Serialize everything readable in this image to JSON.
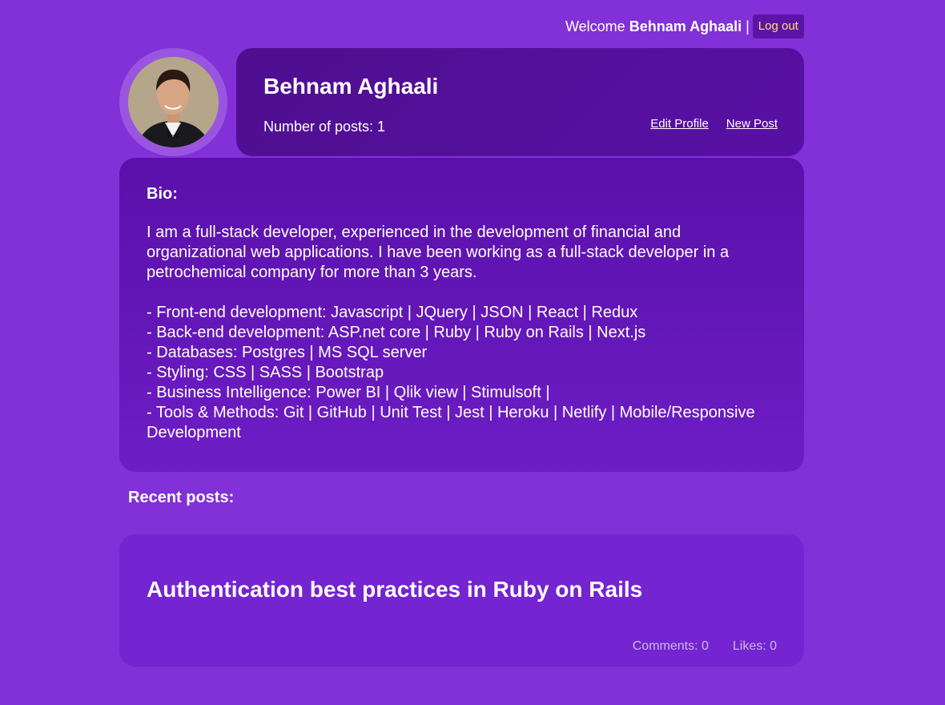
{
  "topbar": {
    "welcome": "Welcome",
    "user_name": "Behnam Aghaali",
    "separator": "|",
    "logout_label": "Log out"
  },
  "profile": {
    "name": "Behnam Aghaali",
    "posts_count_label": "Number of posts: 1",
    "edit_profile_label": "Edit Profile",
    "new_post_label": "New Post"
  },
  "bio": {
    "title": "Bio:",
    "intro": "I am a full-stack developer, experienced in the development of financial and organizational web applications. I have been working as a full-stack developer in a petrochemical company for more than 3 years.",
    "items": [
      "- Front-end development: Javascript | JQuery | JSON | React | Redux",
      "- Back-end development: ASP.net core | Ruby | Ruby on Rails | Next.js",
      "- Databases: Postgres | MS SQL server",
      "- Styling: CSS | SASS | Bootstrap",
      "- Business Intelligence: Power BI | Qlik view | Stimulsoft |",
      "- Tools & Methods: Git | GitHub | Unit Test | Jest | Heroku | Netlify | Mobile/Responsive Development"
    ]
  },
  "recent": {
    "title": "Recent posts:",
    "posts": [
      {
        "title": "Authentication best practices in Ruby on Rails",
        "comments": "Comments: 0",
        "likes": "Likes: 0"
      }
    ]
  }
}
